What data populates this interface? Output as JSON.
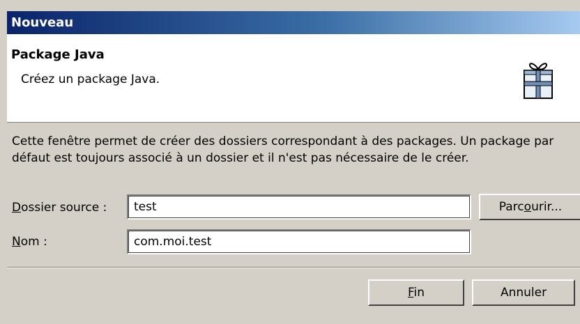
{
  "window": {
    "title": "Nouveau"
  },
  "banner": {
    "title": "Package Java",
    "description": "Créez un package Java.",
    "icon": "package-icon"
  },
  "main": {
    "description": "Cette fenêtre permet de créer des dossiers correspondant à des packages. Un package par défaut est toujours associé à un dossier et il n'est pas nécessaire de le créer.",
    "source_folder": {
      "label_mnemonic": "D",
      "label_rest": "ossier source :",
      "value": "test",
      "browse_label_before": "Parc",
      "browse_label_mnemonic": "o",
      "browse_label_after": "urir..."
    },
    "name": {
      "label_mnemonic": "N",
      "label_rest": "om :",
      "value": "com.moi.test"
    }
  },
  "buttons": {
    "finish_mnemonic": "F",
    "finish_rest": "in",
    "cancel": "Annuler"
  }
}
